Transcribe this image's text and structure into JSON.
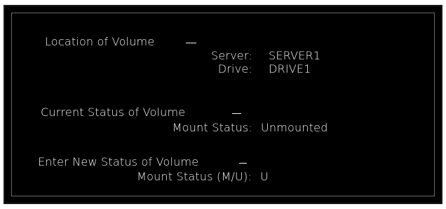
{
  "location": {
    "heading": "Location of Volume",
    "server_label": "Server:",
    "server_value": "SERVER1",
    "drive_label": "Drive:",
    "drive_value": "DRIVE1"
  },
  "current_status": {
    "heading": "Current Status of Volume",
    "mount_label": "Mount Status:",
    "mount_value": "Unmounted"
  },
  "new_status": {
    "heading": "Enter New Status of Volume",
    "mount_label": "Mount Status (M/U):",
    "mount_value": "U"
  },
  "colors": {
    "background": "#000000",
    "text": "#f2f2f2",
    "frame": "#1a1a1a"
  }
}
